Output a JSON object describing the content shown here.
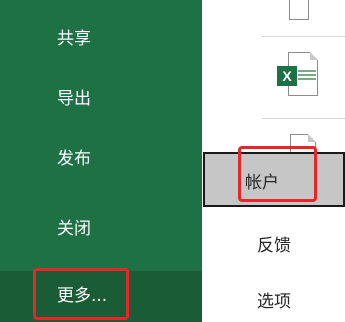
{
  "nav": {
    "items": [
      {
        "label": "共享"
      },
      {
        "label": "导出"
      },
      {
        "label": "发布"
      },
      {
        "label": "关闭"
      }
    ],
    "more_label": "更多..."
  },
  "right_menu": {
    "account_label": "帐户",
    "feedback_label": "反馈",
    "options_label": "选项"
  },
  "file_icons": [
    "document-icon",
    "excel-file-icon",
    "document-icon"
  ],
  "colors": {
    "nav_bg": "#1e7145",
    "nav_more_bg": "#1a5c36",
    "highlight": "#e8262a",
    "account_bg": "#c6c6c6"
  }
}
